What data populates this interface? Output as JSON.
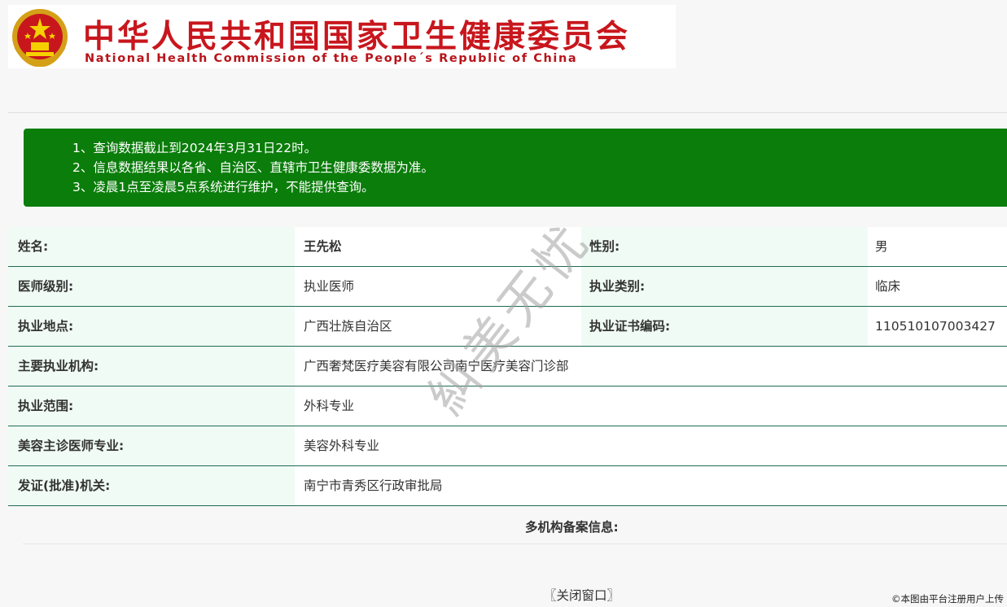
{
  "header": {
    "title_cn": "中华人民共和国国家卫生健康委员会",
    "title_en": "National Health Commission of the People´s Republic of China",
    "emblem_icon": "national-emblem-icon",
    "brand_color": "#c8161d"
  },
  "notice": {
    "bg_color": "#0a7d0a",
    "lines": [
      "1、查询数据截止到2024年3月31日22时。",
      "2、信息数据结果以各省、自治区、直辖市卫生健康委数据为准。",
      "3、凌晨1点至凌晨5点系统进行维护，不能提供查询。"
    ]
  },
  "info": {
    "name_label": "姓名:",
    "name_value": "王先松",
    "gender_label": "性别:",
    "gender_value": "男",
    "level_label": "医师级别:",
    "level_value": "执业医师",
    "category_label": "执业类别:",
    "category_value": "临床",
    "location_label": "执业地点:",
    "location_value": "广西壮族自治区",
    "cert_label": "执业证书编码:",
    "cert_value": "110510107003427",
    "org_label": "主要执业机构:",
    "org_value": "广西奢梵医疗美容有限公司南宁医疗美容门诊部",
    "scope_label": "执业范围:",
    "scope_value": "外科专业",
    "cosmetic_label": "美容主诊医师专业:",
    "cosmetic_value": "美容外科专业",
    "issuer_label": "发证(批准)机关:",
    "issuer_value": "南宁市青秀区行政审批局"
  },
  "multi_org_label": "多机构备案信息:",
  "close_button": "〖关闭窗口〗",
  "watermark": "糾美无忧",
  "footer_mark": "©本图由平台注册用户上传"
}
